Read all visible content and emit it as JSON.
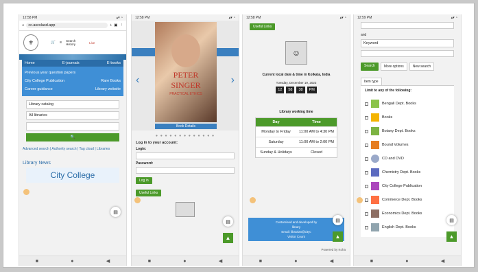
{
  "phones": [
    {
      "status_time": "12:58 PM",
      "status_icons": "▴▾ ◔",
      "url": "cc.ascslasd.app",
      "header_actions": [
        "Search History",
        "Live"
      ],
      "menu": {
        "home": "Home",
        "ejournals": "E-journals",
        "ebooks": "E-books",
        "items": [
          [
            "Previous year question papers",
            ""
          ],
          [
            "City College Publication",
            "Rare Books"
          ],
          [
            "Career guidance",
            "Library website"
          ]
        ]
      },
      "search": {
        "catalog": "Library catalog",
        "libraries": "All libraries"
      },
      "links": "Advanced search | Authority search | Tag cloud | Libraries",
      "news_title": "Library News",
      "news_college": "City College"
    },
    {
      "status_time": "12:58 PM",
      "book_author_line1": "PETER",
      "book_author_line2": "SINGER",
      "book_subtitle": "PRACTICAL ETHICS",
      "book_details": "Book Details",
      "login_heading": "Log in to your account:",
      "login_label": "Login:",
      "password_label": "Password:",
      "login_button": "Log in",
      "useful_links": "Useful Links"
    },
    {
      "status_time": "12:58 PM",
      "useful_links": "Useful Links",
      "current_time_heading": "Current local date & time in Kolkata, India",
      "date": "Tuesday, December 19, 2023",
      "clock": [
        "12",
        "58",
        "38",
        "PM"
      ],
      "working_time_heading": "Library working time",
      "table_headers": [
        "Day",
        "Time"
      ],
      "table_rows": [
        [
          "Monday to Friday",
          "11:00 AM to 4:30 PM"
        ],
        [
          "Saturday",
          "11:00 AM to 2:00 PM"
        ],
        [
          "Sunday & Holidays",
          "Closed"
        ]
      ],
      "footer_line1": "Customised and developed by",
      "footer_line2": "library",
      "footer_email": "Email: librarian@cityc",
      "footer_visitor": "Visitor Count",
      "powered_by": "Powered by Koha"
    },
    {
      "status_time": "12:59 PM",
      "and_label": "and",
      "keyword": "Keyword",
      "search_button": "Search",
      "more_options": "More options",
      "new_search": "New search",
      "item_type_tab": "Item type",
      "limit_heading": "Limit to any of the following:",
      "item_types": [
        "Bengali Dept. Books",
        "Books",
        "Botany Dept. Books",
        "Bound Volumes",
        "CD and DVD",
        "Chemistry Dept. Books",
        "City College Publication",
        "Commerce Dept. Books",
        "Economics Dept. Books",
        "English Dept. Books"
      ]
    }
  ]
}
